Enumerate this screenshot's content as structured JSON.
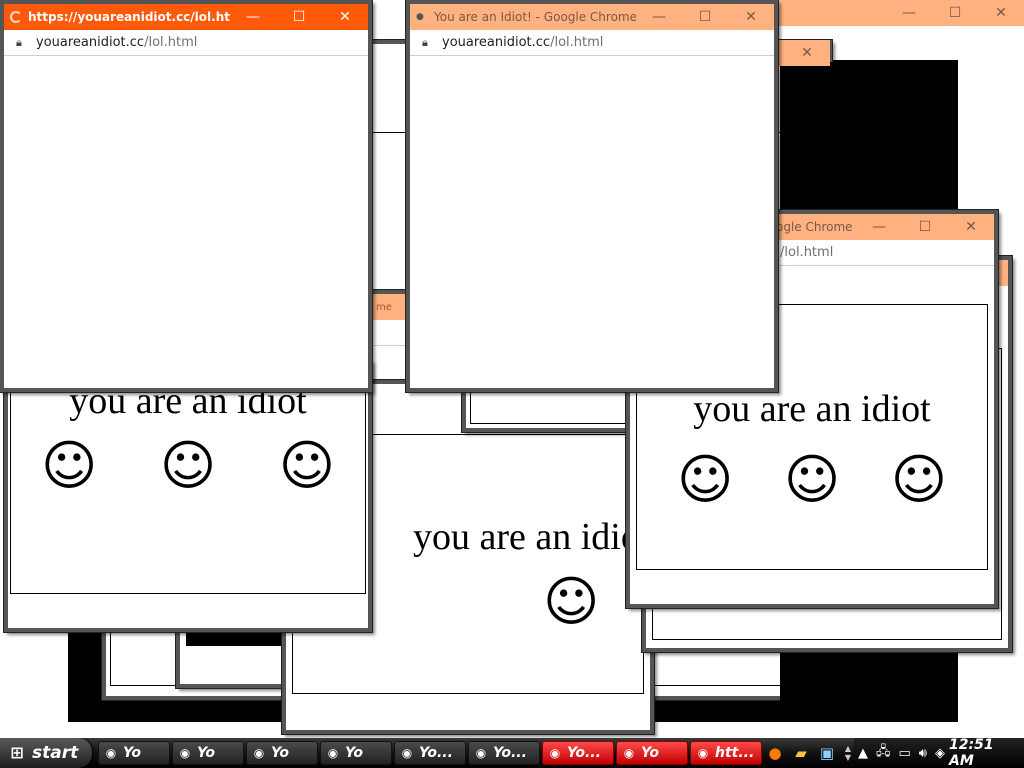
{
  "popup": {
    "heading": "you are an idiot",
    "smiley": "☺"
  },
  "windows": {
    "front_left": {
      "title": "https://youareanidiot.cc/lol.html...",
      "url_host": "youareanidiot.cc",
      "url_path": "/lol.html"
    },
    "front_center": {
      "title": "You are an Idiot! - Google Chrome",
      "url_host": "youareanidiot.cc",
      "url_path": "/lol.html"
    },
    "right_mid": {
      "title": "ogle Chrome",
      "url_path": "/lol.html"
    }
  },
  "window_controls": {
    "minimize": "—",
    "maximize": "☐",
    "close": "✕"
  },
  "taskbar": {
    "start_label": "start",
    "tasks": [
      "Yo",
      "Yo",
      "Yo",
      "Yo",
      "Yo",
      "Yo...",
      "Yo...",
      "Yo...",
      "htt..."
    ],
    "clock": "12:51 AM"
  },
  "colors": {
    "titlebar_active": "#ff5a0a",
    "titlebar_inactive": "#ffb280",
    "taskbar_red": "#e00000"
  },
  "icons": {
    "start": "windows-flag-icon",
    "chrome": "chrome-icon",
    "firefox": "firefox-icon",
    "lock": "lock-icon"
  }
}
